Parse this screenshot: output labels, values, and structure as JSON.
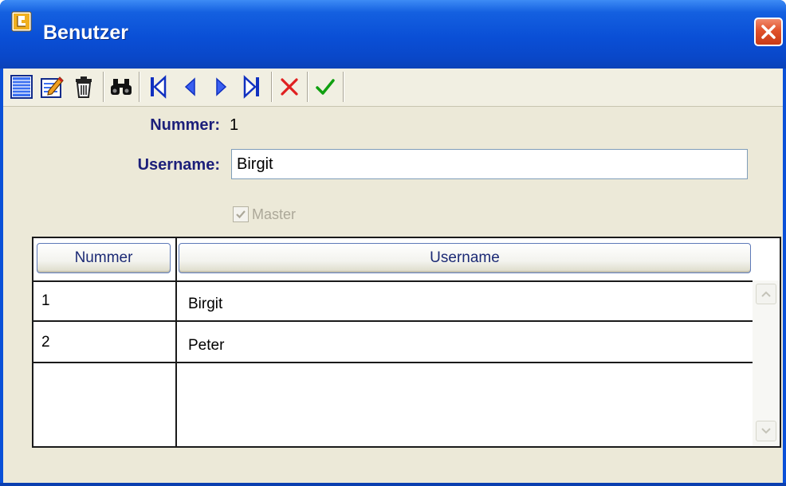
{
  "window": {
    "title": "Benutzer",
    "titlebar_color": "#0a4fd6",
    "close_icon": "close-x-icon"
  },
  "toolbar": {
    "buttons": [
      {
        "name": "list-view-icon",
        "tooltip": ""
      },
      {
        "name": "edit-record-icon",
        "tooltip": ""
      },
      {
        "name": "trash-icon",
        "tooltip": ""
      },
      {
        "name": "binoculars-search-icon",
        "tooltip": ""
      },
      {
        "name": "first-record-icon",
        "tooltip": ""
      },
      {
        "name": "previous-record-icon",
        "tooltip": ""
      },
      {
        "name": "next-record-icon",
        "tooltip": ""
      },
      {
        "name": "last-record-icon",
        "tooltip": ""
      },
      {
        "name": "cancel-x-icon",
        "tooltip": ""
      },
      {
        "name": "confirm-check-icon",
        "tooltip": ""
      }
    ],
    "accent_blue": "#1f5fe0",
    "cancel_color": "#e02020",
    "confirm_color": "#10a010"
  },
  "form": {
    "nummer_label": "Nummer:",
    "nummer_value": "1",
    "username_label": "Username:",
    "username_value": "Birgit",
    "master_label": "Master",
    "master_checked": true,
    "master_enabled": false,
    "label_color": "#1c1f7a"
  },
  "grid": {
    "columns": [
      "Nummer",
      "Username"
    ],
    "rows": [
      {
        "nummer": "1",
        "username": "Birgit"
      },
      {
        "nummer": "2",
        "username": "Peter"
      }
    ]
  }
}
